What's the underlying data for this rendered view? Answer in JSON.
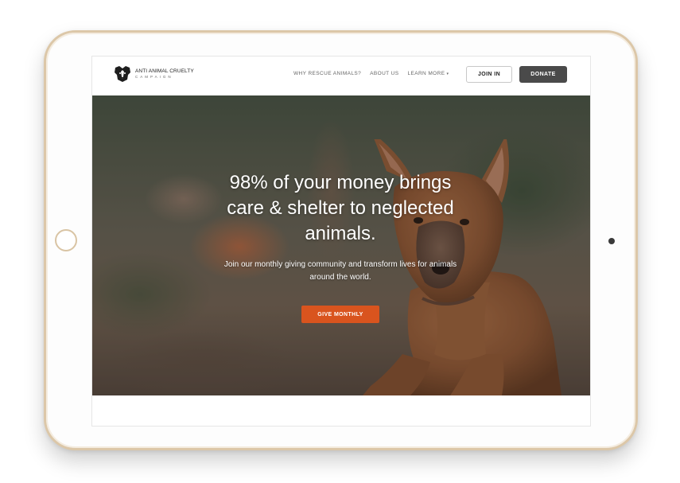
{
  "nav": {
    "logo_line1": "ANTI ANIMAL CRUELTY",
    "logo_line2": "CAMPAIGN",
    "links": [
      {
        "label": "WHY RESCUE ANIMALS?"
      },
      {
        "label": "ABOUT US"
      },
      {
        "label": "LEARN MORE"
      }
    ],
    "join_label": "JOIN IN",
    "donate_label": "DONATE"
  },
  "hero": {
    "title": "98% of your money brings care & shelter to neglected animals.",
    "subtitle": "Join our monthly giving community and transform lives for animals around the world.",
    "cta_label": "GIVE MONTHLY"
  },
  "colors": {
    "cta": "#d9541e",
    "donate": "#4a4a4a",
    "frame_trim": "#dcc7a8"
  },
  "icons": {
    "logo": "dog-head-icon",
    "dropdown": "caret-down-icon"
  }
}
